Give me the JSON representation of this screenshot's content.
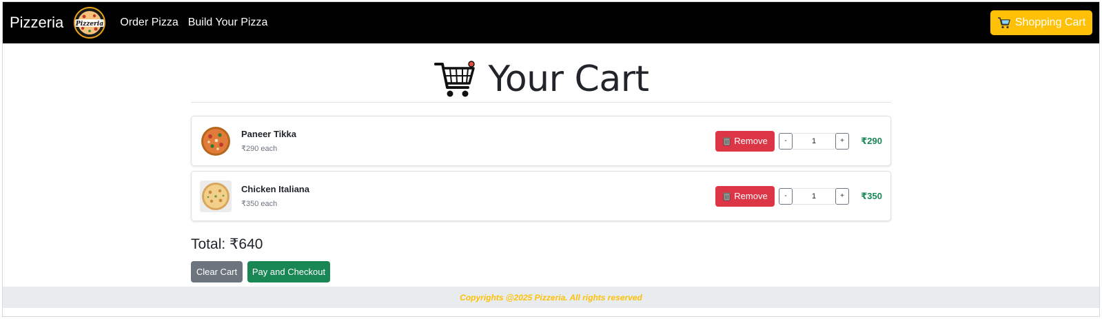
{
  "navbar": {
    "brand": "Pizzeria",
    "logo_text": "Pizzeria",
    "links": [
      {
        "label": "Order Pizza"
      },
      {
        "label": "Build Your Pizza"
      }
    ],
    "cart_button": {
      "label": "Shopping Cart",
      "icon": "shopping-cart-icon"
    }
  },
  "page": {
    "title": "Your Cart",
    "title_icon": "shopping-cart-icon"
  },
  "cart": {
    "currency": "₹",
    "items": [
      {
        "name": "Paneer Tikka",
        "unit_price": "₹290 each",
        "remove_label": "Remove",
        "decrement": "-",
        "quantity": "1",
        "increment": "+",
        "line_total": "₹290",
        "image": "pizza-paneer-tikka"
      },
      {
        "name": "Chicken Italiana",
        "unit_price": "₹350 each",
        "remove_label": "Remove",
        "decrement": "-",
        "quantity": "1",
        "increment": "+",
        "line_total": "₹350",
        "image": "pizza-chicken-italiana"
      }
    ],
    "total": "Total: ₹640",
    "clear_label": "Clear Cart",
    "checkout_label": "Pay and Checkout"
  },
  "footer": {
    "text": "Copyrights @2025 Pizzeria. All rights reserved"
  },
  "colors": {
    "navbar_bg": "#000000",
    "warning": "#ffc107",
    "danger": "#dc3545",
    "success": "#198754",
    "secondary": "#6c757d",
    "footer_bg": "#e9ecef"
  }
}
